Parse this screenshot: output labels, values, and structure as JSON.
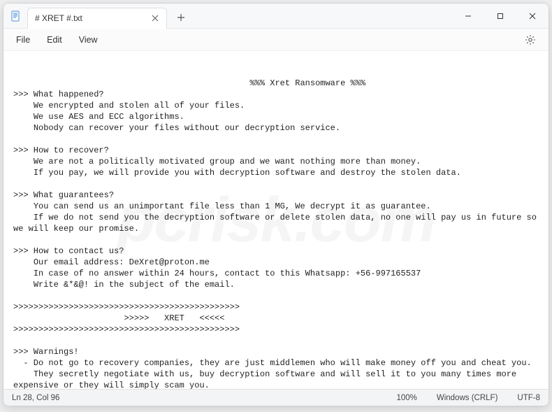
{
  "titlebar": {
    "tab_title": "# XRET #.txt"
  },
  "menubar": {
    "file": "File",
    "edit": "Edit",
    "view": "View"
  },
  "document": {
    "content": "                                           %%% Xret Ransomware %%%\n>>> What happened?\n    We encrypted and stolen all of your files.\n    We use AES and ECC algorithms.\n    Nobody can recover your files without our decryption service.\n\n>>> How to recover?\n    We are not a politically motivated group and we want nothing more than money.\n    If you pay, we will provide you with decryption software and destroy the stolen data.\n\n>>> What guarantees?\n    You can send us an unimportant file less than 1 MG, We decrypt it as guarantee.\n    If we do not send you the decryption software or delete stolen data, no one will pay us in future so we will keep our promise.\n\n>>> How to contact us?\n    Our email address: DeXret@proton.me\n    In case of no answer within 24 hours, contact to this Whatsapp: +56-997165537\n    Write &*&@! in the subject of the email.\n\n>>>>>>>>>>>>>>>>>>>>>>>>>>>>>>>>>>>>>>>>>>>>>\n                      >>>>>   XRET   <<<<<\n>>>>>>>>>>>>>>>>>>>>>>>>>>>>>>>>>>>>>>>>>>>>>\n\n>>> Warnings!\n  - Do not go to recovery companies, they are just middlemen who will make money off you and cheat you.\n    They secretly negotiate with us, buy decryption software and will sell it to you many times more expensive or they will simply scam you.\n  - Do not hesitate for a long time. The faster you pay, the lower the price.\n  - Do not delete or modify encrypted files, it will lead to problems with decryption of files."
  },
  "statusbar": {
    "position": "Ln 28, Col 96",
    "zoom": "100%",
    "line_ending": "Windows (CRLF)",
    "encoding": "UTF-8"
  },
  "watermark": "pcrisk.com"
}
